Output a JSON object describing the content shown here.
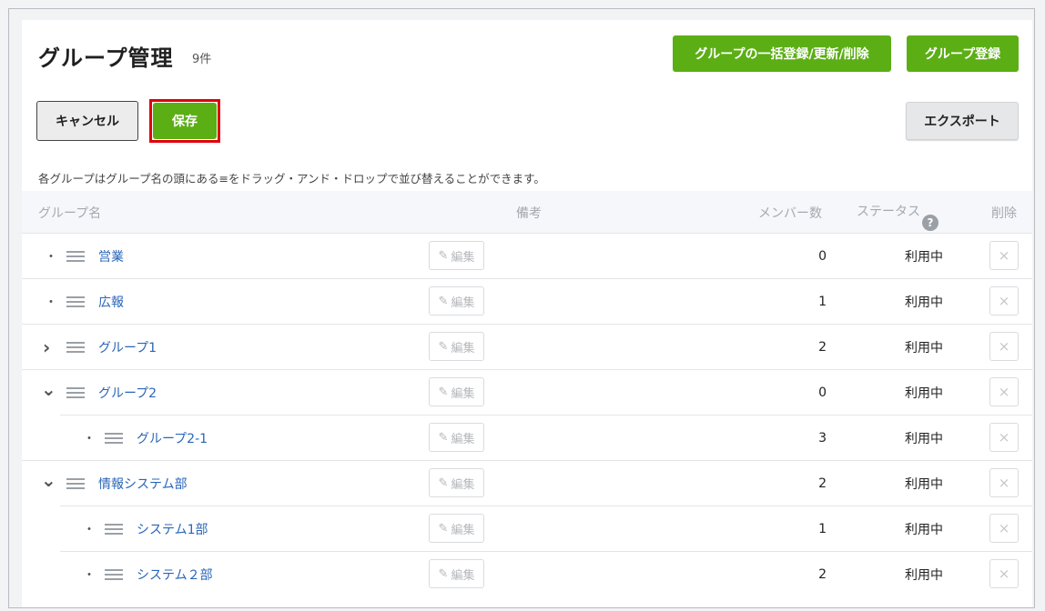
{
  "header": {
    "title": "グループ管理",
    "count": "9件",
    "bulk_button": "グループの一括登録/更新/削除",
    "register_button": "グループ登録"
  },
  "toolbar": {
    "cancel_label": "キャンセル",
    "save_label": "保存",
    "export_label": "エクスポート",
    "hint": "各グループはグループ名の頭にある≡をドラッグ・アンド・ドロップで並び替えることができます。"
  },
  "table": {
    "columns": {
      "name": "グループ名",
      "note": "備考",
      "members": "メンバー数",
      "status": "ステータス",
      "status_help": "?",
      "delete": "削除"
    },
    "edit_label": "編集",
    "rows": [
      {
        "name": "営業",
        "members": "0",
        "status": "利用中"
      },
      {
        "name": "広報",
        "members": "1",
        "status": "利用中"
      },
      {
        "name": "グループ1",
        "members": "2",
        "status": "利用中"
      },
      {
        "name": "グループ2",
        "members": "0",
        "status": "利用中"
      },
      {
        "name": "グループ2-1",
        "members": "3",
        "status": "利用中"
      },
      {
        "name": "情報システム部",
        "members": "2",
        "status": "利用中"
      },
      {
        "name": "システム1部",
        "members": "1",
        "status": "利用中"
      },
      {
        "name": "システム２部",
        "members": "2",
        "status": "利用中"
      }
    ]
  },
  "icons": {
    "bullet": "・",
    "chevron_right": "›",
    "chevron_down": "⌄",
    "close": "×"
  },
  "colors": {
    "accent_green": "#5cae15",
    "link_blue": "#2a66b8",
    "highlight_red": "#e0000b"
  }
}
